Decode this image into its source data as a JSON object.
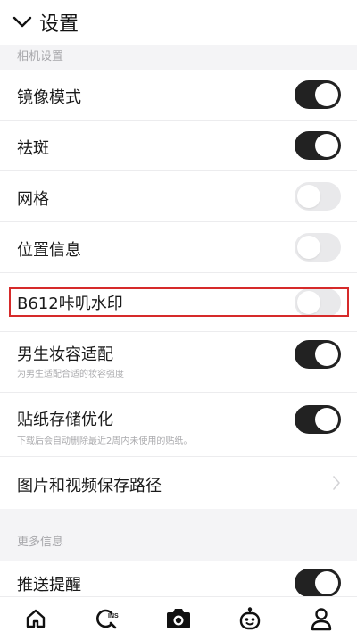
{
  "header": {
    "title": "设置"
  },
  "sections": {
    "camera_label": "相机设置",
    "more_label": "更多信息"
  },
  "settings": [
    {
      "title": "镜像模式",
      "enabled": true
    },
    {
      "title": "祛斑",
      "enabled": true
    },
    {
      "title": "网格",
      "enabled": false
    },
    {
      "title": "位置信息",
      "enabled": false
    },
    {
      "title": "B612咔叽水印",
      "enabled": false
    },
    {
      "title": "男生妆容适配",
      "subtitle": "为男生适配合适的妆容强度",
      "enabled": true
    },
    {
      "title": "贴纸存储优化",
      "subtitle": "下载后会自动删除最近2周内未使用的贴纸。",
      "enabled": true
    },
    {
      "title": "图片和视频保存路径"
    },
    {
      "title": "推送提醒",
      "enabled": true
    }
  ],
  "bottom_nav": [
    "home-icon",
    "search-ins-icon",
    "camera-icon",
    "character-icon",
    "profile-icon"
  ],
  "colors": {
    "toggle_on": "#222222",
    "toggle_off": "#e9e9eb",
    "highlight": "#d62a2a"
  }
}
